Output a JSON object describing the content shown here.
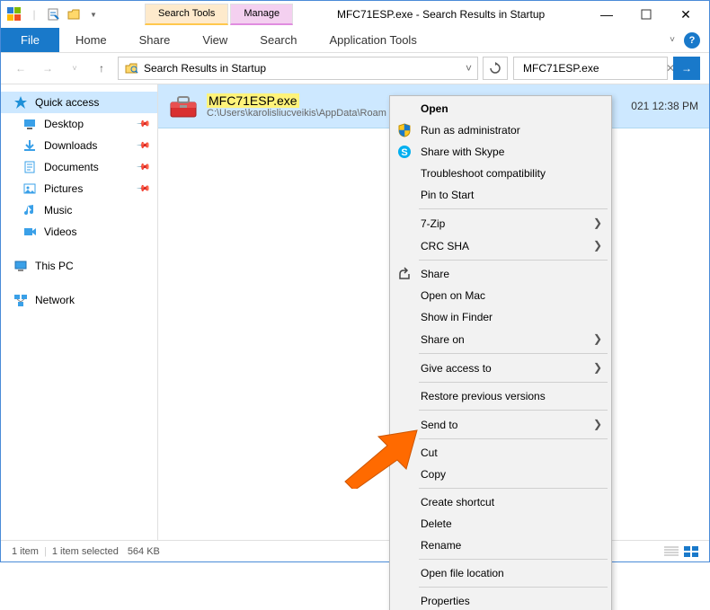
{
  "titlebar": {
    "tool_tabs": [
      {
        "label": "Search Tools",
        "sub": "Search",
        "cls": "search"
      },
      {
        "label": "Manage",
        "sub": "Application Tools",
        "cls": "manage"
      }
    ],
    "title": "MFC71ESP.exe - Search Results in Startup"
  },
  "ribbon": {
    "file": "File",
    "tabs": [
      "Home",
      "Share",
      "View",
      "Search",
      "Application Tools"
    ]
  },
  "address": {
    "crumb": "Search Results in Startup",
    "search_value": "MFC71ESP.exe"
  },
  "sidebar": {
    "quick_access": "Quick access",
    "items": [
      {
        "label": "Desktop",
        "icon": "desktop",
        "pinned": true
      },
      {
        "label": "Downloads",
        "icon": "downloads",
        "pinned": true
      },
      {
        "label": "Documents",
        "icon": "documents",
        "pinned": true
      },
      {
        "label": "Pictures",
        "icon": "pictures",
        "pinned": true
      },
      {
        "label": "Music",
        "icon": "music",
        "pinned": false
      },
      {
        "label": "Videos",
        "icon": "videos",
        "pinned": false
      }
    ],
    "this_pc": "This PC",
    "network": "Network"
  },
  "result": {
    "name": "MFC71ESP.exe",
    "path": "C:\\Users\\karolisliucveikis\\AppData\\Roam",
    "date": "021 12:38 PM"
  },
  "context_menu": [
    {
      "label": "Open",
      "bold": true
    },
    {
      "label": "Run as administrator",
      "icon": "shield"
    },
    {
      "label": "Share with Skype",
      "icon": "skype"
    },
    {
      "label": "Troubleshoot compatibility"
    },
    {
      "label": "Pin to Start"
    },
    {
      "sep": true
    },
    {
      "label": "7-Zip",
      "sub": true
    },
    {
      "label": "CRC SHA",
      "sub": true
    },
    {
      "sep": true
    },
    {
      "label": "Share",
      "icon": "share"
    },
    {
      "label": "Open on Mac"
    },
    {
      "label": "Show in Finder"
    },
    {
      "label": "Share on",
      "sub": true
    },
    {
      "sep": true
    },
    {
      "label": "Give access to",
      "sub": true
    },
    {
      "sep": true
    },
    {
      "label": "Restore previous versions"
    },
    {
      "sep": true
    },
    {
      "label": "Send to",
      "sub": true
    },
    {
      "sep": true
    },
    {
      "label": "Cut"
    },
    {
      "label": "Copy"
    },
    {
      "sep": true
    },
    {
      "label": "Create shortcut"
    },
    {
      "label": "Delete"
    },
    {
      "label": "Rename"
    },
    {
      "sep": true
    },
    {
      "label": "Open file location"
    },
    {
      "sep": true
    },
    {
      "label": "Properties"
    }
  ],
  "statusbar": {
    "count": "1 item",
    "selected": "1 item selected",
    "size": "564 KB"
  }
}
